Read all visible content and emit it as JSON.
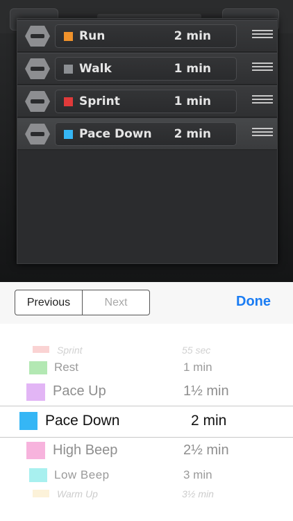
{
  "workout_list": {
    "items": [
      {
        "name": "Run",
        "duration": "2 min",
        "color": "#f0922b"
      },
      {
        "name": "Walk",
        "duration": "1 min",
        "color": "#8c8f93"
      },
      {
        "name": "Sprint",
        "duration": "1 min",
        "color": "#e03a3a"
      },
      {
        "name": "Pace Down",
        "duration": "2 min",
        "color": "#35b6f5"
      }
    ]
  },
  "toolbar": {
    "previous_label": "Previous",
    "next_label": "Next",
    "done_label": "Done",
    "accent_color": "#1a7cf3"
  },
  "picker": {
    "rows": [
      {
        "name": "Sprint",
        "duration": "55 sec",
        "color": "#f5a0a0"
      },
      {
        "name": "Rest",
        "duration": "1 min",
        "color": "#b3e8b3"
      },
      {
        "name": "Pace Up",
        "duration": "1½ min",
        "color": "#e2b5f5"
      },
      {
        "name": "Pace Down",
        "duration": "2 min",
        "color": "#35b6f5",
        "selected": true
      },
      {
        "name": "High Beep",
        "duration": "2½ min",
        "color": "#f7b3dd"
      },
      {
        "name": "Low Beep",
        "duration": "3 min",
        "color": "#a8f0ef"
      },
      {
        "name": "Warm Up",
        "duration": "3½ min",
        "color": "#fbe7b5"
      }
    ]
  }
}
